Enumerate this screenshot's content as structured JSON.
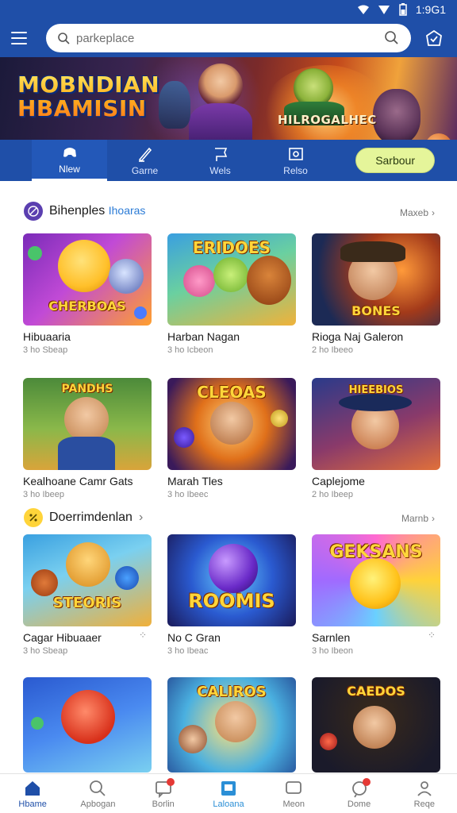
{
  "status": {
    "time": "1:9G1"
  },
  "search": {
    "placeholder": "parkeplace"
  },
  "banner": {
    "title_line1": "MOBNDIAN",
    "title_line2": "HBAMISIN",
    "tagline": "HILROGALHEC"
  },
  "tabs": [
    {
      "label": "Nlew",
      "icon": "controller-icon"
    },
    {
      "label": "Garne",
      "icon": "pen-icon"
    },
    {
      "label": "Wels",
      "icon": "flag-icon"
    },
    {
      "label": "Relso",
      "icon": "book-icon"
    }
  ],
  "tab_cta": "Sarbour",
  "sections": [
    {
      "title": "Bihenples",
      "accent": "Ihoaras",
      "more": "Maxeb"
    },
    {
      "title": "Doerrimdenlan",
      "more": "Marnb"
    }
  ],
  "games": [
    {
      "title": "Hibuaaria",
      "meta": "3 ho Sbeap",
      "thumb_text": "CHERBOAS"
    },
    {
      "title": "Harban Nagan",
      "meta": "3 ho Icbeon",
      "thumb_text": "ERIDOES"
    },
    {
      "title": "Rioga Naj Galeron",
      "meta": "2 ho Ibeeo",
      "thumb_text": "BONES"
    },
    {
      "title": "Kealhoane Camr Gats",
      "meta": "3 ho Ibeep",
      "thumb_text": "PANDHS"
    },
    {
      "title": "Marah Tles",
      "meta": "3 ho Ibeec",
      "thumb_text": "CLEOAS"
    },
    {
      "title": "Caplejome",
      "meta": "2 ho Ibeep",
      "thumb_text": "HIEEBIOS"
    },
    {
      "title": "Cagar Hibuaaer",
      "meta": "3 ho Sbeap",
      "thumb_text": "STEORIS"
    },
    {
      "title": "No C Gran",
      "meta": "3 ho Ibeac",
      "thumb_text": "ROOMIS"
    },
    {
      "title": "Sarnlen",
      "meta": "3 ho Ibeon",
      "thumb_text": "GEKSANS"
    },
    {
      "title": "",
      "meta": "",
      "thumb_text": ""
    },
    {
      "title": "",
      "meta": "",
      "thumb_text": "CALIROS"
    },
    {
      "title": "",
      "meta": "",
      "thumb_text": "CAEDOS"
    }
  ],
  "bottom_nav": [
    {
      "label": "Hbame",
      "icon": "home-icon"
    },
    {
      "label": "Apbogan",
      "icon": "search-icon"
    },
    {
      "label": "Borlin",
      "icon": "message-icon"
    },
    {
      "label": "Laloana",
      "icon": "library-icon"
    },
    {
      "label": "Meon",
      "icon": "chat-icon"
    },
    {
      "label": "Dome",
      "icon": "notifications-icon"
    },
    {
      "label": "Reqe",
      "icon": "profile-icon"
    }
  ],
  "colors": {
    "primary": "#1f4fa8",
    "cta": "#e5f59a",
    "accent": "#2b7bd6",
    "badge": "#e53935"
  }
}
